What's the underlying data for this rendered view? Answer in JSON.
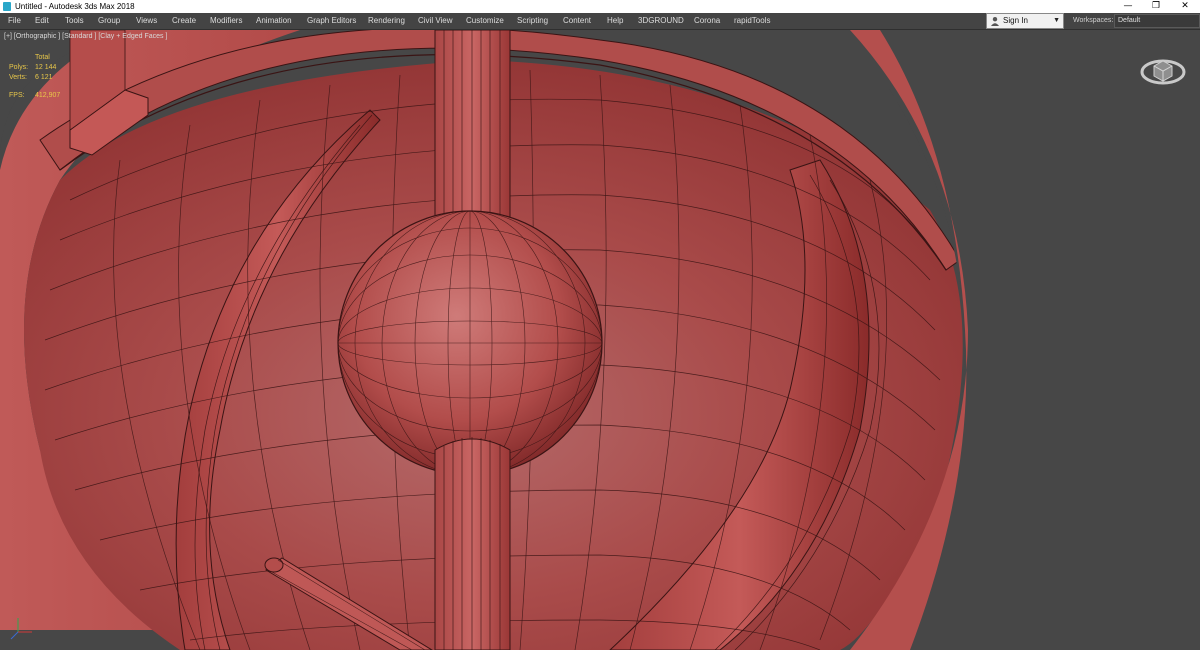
{
  "window": {
    "title": "Untitled - Autodesk 3ds Max 2018",
    "controls": {
      "minimize": "—",
      "restore": "❐",
      "close": "✕"
    }
  },
  "menu": {
    "items": [
      "File",
      "Edit",
      "Tools",
      "Group",
      "Views",
      "Create",
      "Modifiers",
      "Animation",
      "Graph Editors",
      "Rendering",
      "Civil View",
      "Customize",
      "Scripting",
      "Content",
      "Help",
      "3DGROUND",
      "Corona",
      "rapidTools"
    ]
  },
  "account": {
    "signin_label": "Sign In",
    "workspaces_label": "Workspaces:",
    "workspace_value": "Default"
  },
  "viewport": {
    "label": "[+] [Orthographic ] [Standard ] [Clay + Edged Faces ]",
    "stats": {
      "header": "Total",
      "polys_label": "Polys:",
      "polys_value": "12 144",
      "verts_label": "Verts:",
      "verts_value": "6 121",
      "fps_label": "FPS:",
      "fps_value": "412,907"
    },
    "colors": {
      "clay": "#c0504e",
      "wire": "#3a1414",
      "background": "#474747"
    }
  }
}
